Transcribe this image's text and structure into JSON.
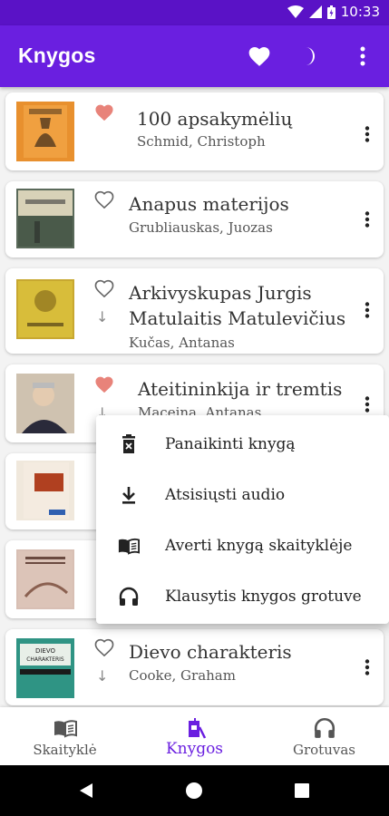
{
  "status_bar": {
    "time": "10:33"
  },
  "app_bar": {
    "title": "Knygos",
    "actions": [
      "heart-icon",
      "moon-icon",
      "more-vert-icon"
    ]
  },
  "books": [
    {
      "title": "100 apsakymėlių",
      "author": "Schmid, Christoph",
      "favorite": true
    },
    {
      "title": "Anapus materijos",
      "author": "Grubliauskas, Juozas",
      "favorite": false
    },
    {
      "title": "Arkivyskupas Jurgis Matulaitis Matulevičius",
      "title_line1": "Arkivyskupas Jurgis",
      "title_line2": "Matulaitis Matulevičius",
      "author": "Kučas, Antanas",
      "favorite": false
    },
    {
      "title": "Ateitininkija ir tremtis",
      "author": "Maceina, Antanas",
      "favorite": true
    },
    {
      "title": "",
      "author": "",
      "favorite": false
    },
    {
      "title": "",
      "author": "",
      "favorite": false
    },
    {
      "title": "Dievo charakteris",
      "author": "Cooke, Graham",
      "favorite": false
    }
  ],
  "context_menu": {
    "items": [
      {
        "label": "Panaikinti knygą",
        "icon": "trash-icon"
      },
      {
        "label": "Atsisiųsti audio",
        "icon": "download-icon"
      },
      {
        "label": "Averti knygą skaityklėje",
        "icon": "book-open-icon"
      },
      {
        "label": "Klausytis knygos grotuve",
        "icon": "headphones-icon"
      }
    ]
  },
  "bottom_nav": {
    "items": [
      {
        "label": "Skaityklė",
        "icon": "book-open-icon",
        "active": false
      },
      {
        "label": "Knygos",
        "icon": "library-icon",
        "active": true
      },
      {
        "label": "Grotuvas",
        "icon": "headphones-icon",
        "active": false
      }
    ]
  },
  "colors": {
    "primary": "#6a1fe0",
    "status_bar": "#5a12c6",
    "favorite": "#e8837a"
  }
}
